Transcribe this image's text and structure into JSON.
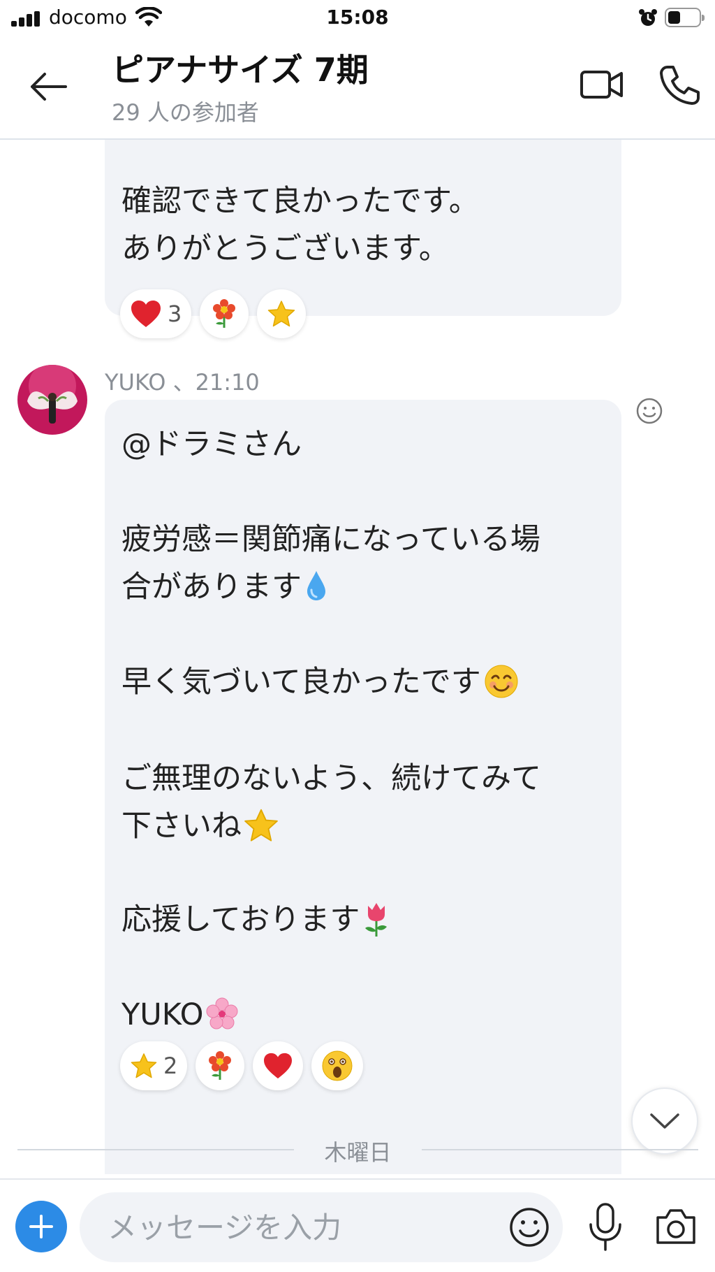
{
  "status_bar": {
    "carrier": "docomo",
    "time": "15:08",
    "battery_level": 0.4
  },
  "header": {
    "title": "ピアナサイズ 7期",
    "participants": "29 人の参加者",
    "icons": [
      "back-arrow-icon",
      "video-camera-icon",
      "phone-icon"
    ]
  },
  "messages": [
    {
      "text": "確認できて良かったです。\nありがとうございます。",
      "reactions": [
        {
          "emoji": "heart",
          "count": "3"
        },
        {
          "emoji": "flower",
          "count": ""
        },
        {
          "emoji": "star",
          "count": ""
        }
      ]
    },
    {
      "sender": "YUKO",
      "time": "21:10",
      "sender_line": "YUKO 、21:10",
      "lines": [
        {
          "text": "@ドラミさん",
          "emoji": ""
        },
        {
          "text": "疲労感＝関節痛になっている場",
          "emoji": ""
        },
        {
          "text": "合があります",
          "emoji": "droplet"
        },
        {
          "text": "早く気づいて良かったです",
          "emoji": "smiling-face"
        },
        {
          "text": "ご無理のないよう、続けてみて",
          "emoji": ""
        },
        {
          "text": "下さいね",
          "emoji": "star"
        },
        {
          "text": "応援しております",
          "emoji": "tulip"
        },
        {
          "text": "YUKO",
          "emoji": "cherry-blossom"
        }
      ],
      "reactions": [
        {
          "emoji": "star",
          "count": "2"
        },
        {
          "emoji": "flower",
          "count": ""
        },
        {
          "emoji": "heart",
          "count": ""
        },
        {
          "emoji": "surprised-face",
          "count": ""
        }
      ]
    }
  ],
  "day_divider": "木曜日",
  "composer": {
    "placeholder": "メッセージを入力"
  },
  "colors": {
    "accent": "#2c8be6",
    "bubble": "#f1f3f7",
    "muted_text": "#8a8f96"
  }
}
